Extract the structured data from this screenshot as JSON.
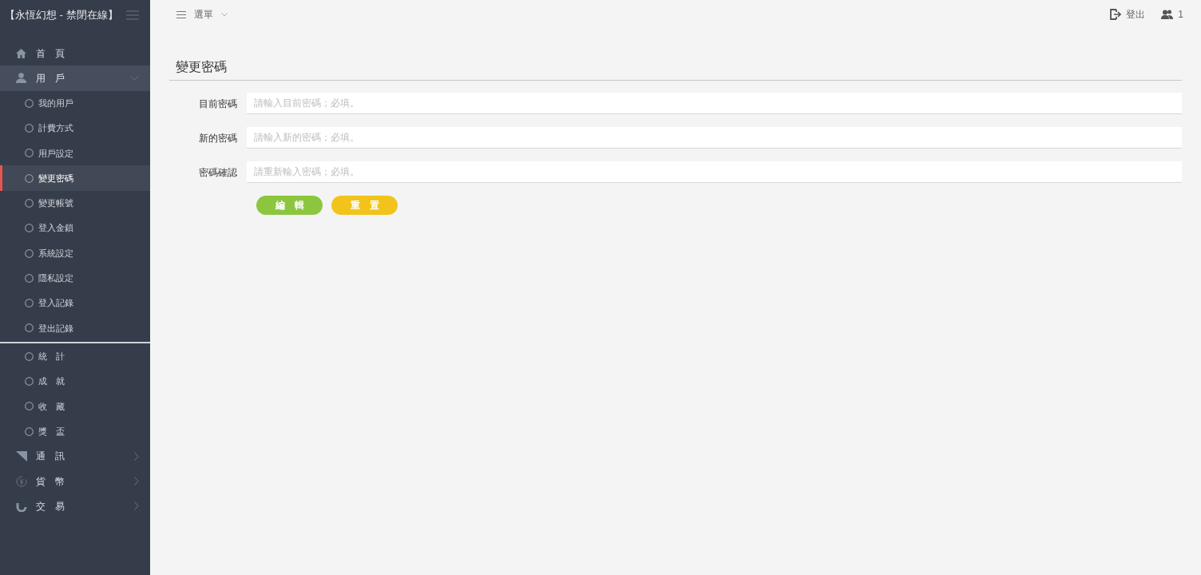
{
  "sidebar": {
    "brand": "【永恆幻想 - 禁閉在線】",
    "items": [
      {
        "kind": "section",
        "label": "首　頁",
        "selected": false
      },
      {
        "kind": "section",
        "label": "用　戶",
        "selected": false,
        "expanded": true
      },
      {
        "kind": "sub",
        "label": "我的用戶",
        "selected": false
      },
      {
        "kind": "sub",
        "label": "計費方式",
        "selected": false
      },
      {
        "kind": "sub",
        "label": "用戶設定",
        "selected": false
      },
      {
        "kind": "sub",
        "label": "變更密碼",
        "selected": true
      },
      {
        "kind": "sub",
        "label": "變更帳號",
        "selected": false
      },
      {
        "kind": "sub",
        "label": "登入金鎖",
        "selected": false
      },
      {
        "kind": "sub",
        "label": "系統設定",
        "selected": false
      },
      {
        "kind": "sub",
        "label": "隱私設定",
        "selected": false
      },
      {
        "kind": "sub",
        "label": "登入記錄",
        "selected": false
      },
      {
        "kind": "sub",
        "label": "登出記錄",
        "selected": false
      },
      {
        "kind": "divider"
      },
      {
        "kind": "sub",
        "label": "統　計",
        "selected": false
      },
      {
        "kind": "sub",
        "label": "成　就",
        "selected": false
      },
      {
        "kind": "sub",
        "label": "收　藏",
        "selected": false
      },
      {
        "kind": "sub",
        "label": "獎　盃",
        "selected": false
      },
      {
        "kind": "section",
        "label": "通　訊",
        "selected": false,
        "expanded": false
      },
      {
        "kind": "section",
        "label": "貨　幣",
        "selected": false,
        "expanded": false
      },
      {
        "kind": "section",
        "label": "交　易",
        "selected": false,
        "expanded": false
      }
    ]
  },
  "topbar": {
    "menu": "選單",
    "logout": "登出",
    "users_online": "1"
  },
  "form": {
    "title": "變更密碼",
    "fields": [
      {
        "label": "目前密碼",
        "placeholder": "請輸入目前密碼；必填。"
      },
      {
        "label": "新的密碼",
        "placeholder": "請輸入新的密碼；必填。"
      },
      {
        "label": "密碼確認",
        "placeholder": "請重新輸入密碼；必填。"
      }
    ],
    "buttons": [
      {
        "kind": "primary",
        "label": "編　輯"
      },
      {
        "kind": "warning",
        "label": "重　置"
      }
    ]
  }
}
